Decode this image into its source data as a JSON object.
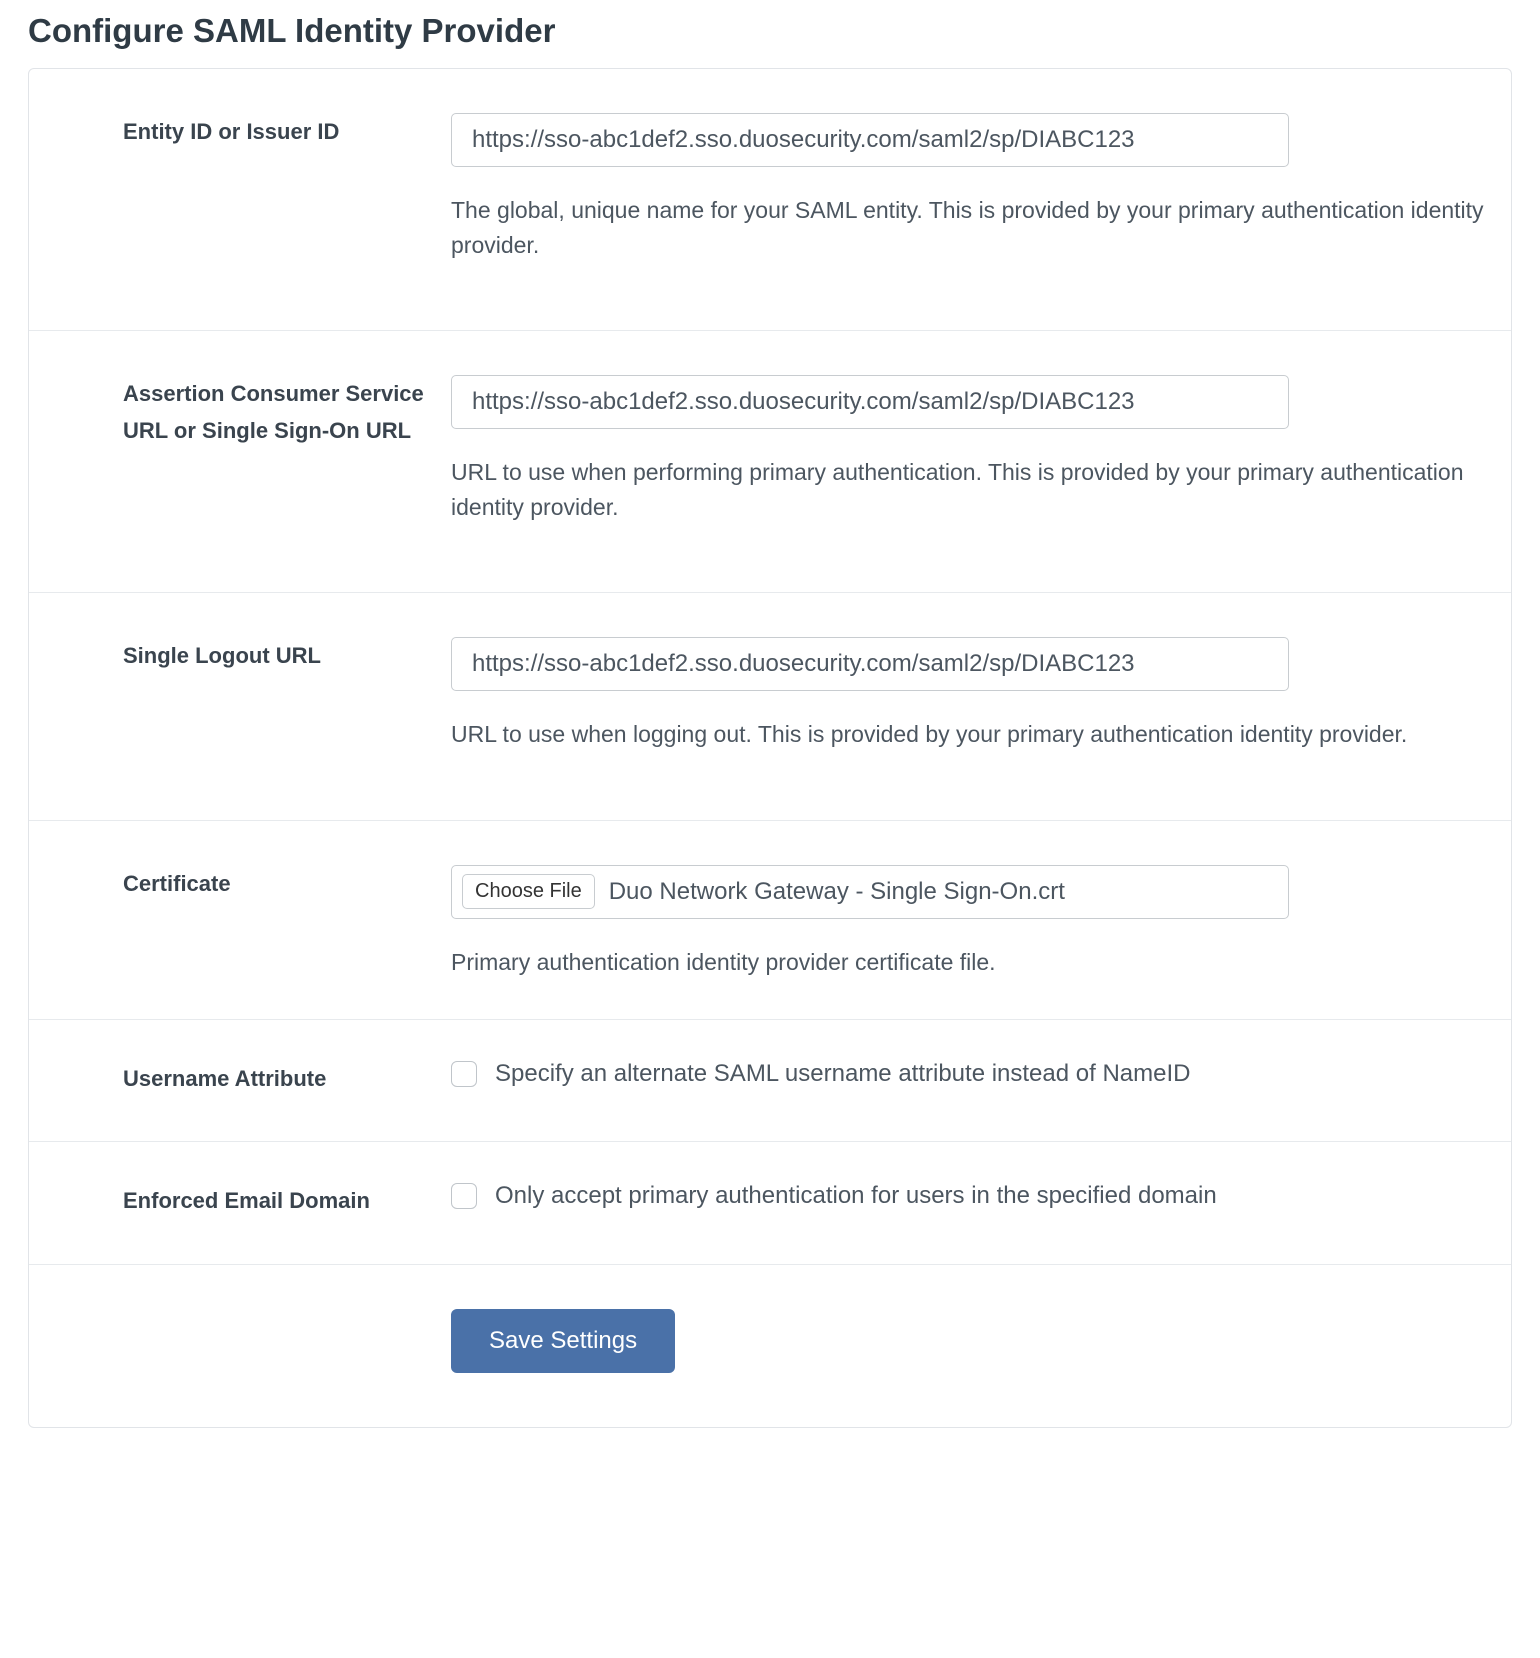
{
  "page_title": "Configure SAML Identity Provider",
  "fields": {
    "entity_id": {
      "label": "Entity ID or Issuer ID",
      "value": "https://sso-abc1def2.sso.duosecurity.com/saml2/sp/DIABC123",
      "help": "The global, unique name for your SAML entity. This is provided by your primary authentication identity provider."
    },
    "acs_url": {
      "label": "Assertion Consumer Service URL or Single Sign-On URL",
      "value": "https://sso-abc1def2.sso.duosecurity.com/saml2/sp/DIABC123",
      "help": "URL to use when performing primary authentication. This is provided by your primary authentication identity provider."
    },
    "slo_url": {
      "label": "Single Logout URL",
      "value": "https://sso-abc1def2.sso.duosecurity.com/saml2/sp/DIABC123",
      "help": "URL to use when logging out. This is provided by your primary authentication identity provider."
    },
    "certificate": {
      "label": "Certificate",
      "choose_button": "Choose File",
      "file_name": "Duo Network Gateway - Single Sign-On.crt",
      "help": "Primary authentication identity provider certificate file."
    },
    "username_attr": {
      "label": "Username Attribute",
      "checkbox_label": "Specify an alternate SAML username attribute instead of NameID",
      "checked": false
    },
    "enforced_domain": {
      "label": "Enforced Email Domain",
      "checkbox_label": "Only accept primary authentication for users in the specified domain",
      "checked": false
    }
  },
  "buttons": {
    "save": "Save Settings"
  }
}
